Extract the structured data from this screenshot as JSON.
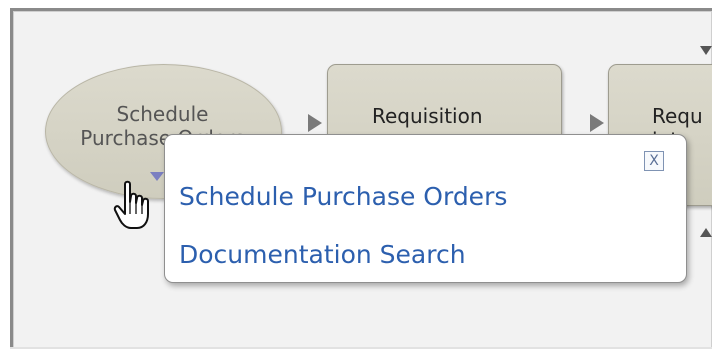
{
  "workflow": {
    "nodes": [
      {
        "label_line1": "Schedule",
        "label_line2": "Purchase Orders"
      },
      {
        "label": "Requisition"
      },
      {
        "label_line1": "Requ",
        "label_line2": "int"
      }
    ]
  },
  "popup": {
    "close_label": "X",
    "links": [
      "Schedule Purchase Orders",
      "Documentation Search"
    ]
  },
  "colors": {
    "node_fill": "#d6d4c6",
    "link": "#2c5fae",
    "background": "#f2f2f2"
  }
}
